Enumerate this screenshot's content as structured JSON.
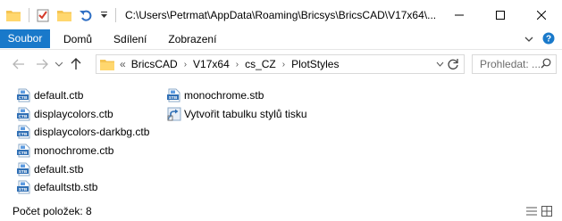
{
  "window": {
    "title": "C:\\Users\\Petrmat\\AppData\\Roaming\\Bricsys\\BricsCAD\\V17x64\\..."
  },
  "ribbon": {
    "tabs": [
      "Soubor",
      "Domů",
      "Sdílení",
      "Zobrazení"
    ]
  },
  "address": {
    "prefix": "«",
    "crumbs": [
      "BricsCAD",
      "V17x64",
      "cs_CZ",
      "PlotStyles"
    ]
  },
  "search": {
    "placeholder": "Prohledat: ..."
  },
  "files": {
    "column1": [
      {
        "name": "default.ctb",
        "icon": "ctb-file-icon"
      },
      {
        "name": "displaycolors.ctb",
        "icon": "ctb-file-icon"
      },
      {
        "name": "displaycolors-darkbg.ctb",
        "icon": "ctb-file-icon"
      },
      {
        "name": "monochrome.ctb",
        "icon": "ctb-file-icon"
      },
      {
        "name": "default.stb",
        "icon": "stb-file-icon"
      },
      {
        "name": "defaultstb.stb",
        "icon": "stb-file-icon"
      }
    ],
    "column2": [
      {
        "name": "monochrome.stb",
        "icon": "stb-file-icon"
      },
      {
        "name": "Vytvořit tabulku stylů tisku",
        "icon": "shortcut-icon"
      }
    ]
  },
  "status": {
    "item_count": "Počet položek: 8"
  },
  "colors": {
    "accent": "#1979ca",
    "folder": "#f5c452"
  }
}
